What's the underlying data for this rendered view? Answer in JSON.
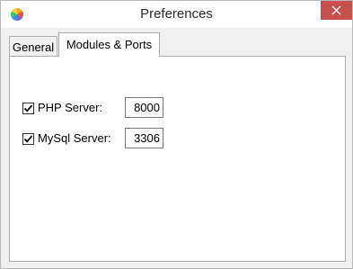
{
  "window": {
    "title": "Preferences",
    "icon": "app-color-wheel-icon"
  },
  "tabs": [
    {
      "label": "General",
      "active": false
    },
    {
      "label": "Modules & Ports",
      "active": true
    }
  ],
  "modules": [
    {
      "label": "PHP Server:",
      "checked": true,
      "port": "8000"
    },
    {
      "label": "MySql Server:",
      "checked": true,
      "port": "3306"
    }
  ],
  "colors": {
    "close_button": "#c7504c",
    "client_background": "#f0f0f0"
  }
}
